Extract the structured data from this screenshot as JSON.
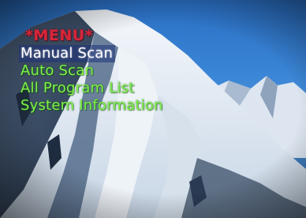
{
  "menu": {
    "title": "*MENU*",
    "items": [
      {
        "label": "Manual Scan",
        "selected": true
      },
      {
        "label": "Auto Scan",
        "selected": false
      },
      {
        "label": "All Program List",
        "selected": false
      },
      {
        "label": "System Information",
        "selected": false
      }
    ]
  },
  "colors": {
    "title": "#d8263a",
    "selected_text": "#ffffff",
    "item_text": "#7df04a",
    "sky": "#3b86d6",
    "snow": "#e9eef5"
  }
}
